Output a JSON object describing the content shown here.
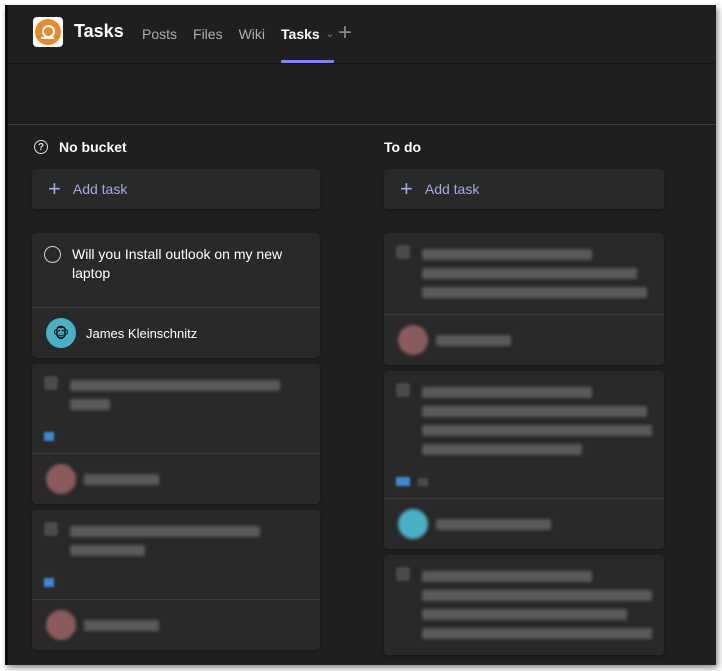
{
  "app": {
    "title": "Tasks",
    "logo_icon": "orange-circle-app-logo-icon",
    "accent_color": "#7f85f5",
    "link_color": "#a7a8e0"
  },
  "tabs": [
    {
      "label": "Posts",
      "active": false
    },
    {
      "label": "Files",
      "active": false
    },
    {
      "label": "Wiki",
      "active": false
    },
    {
      "label": "Tasks",
      "active": true,
      "has_dropdown": true
    }
  ],
  "add_tab_icon": "plus-icon",
  "buckets": [
    {
      "name": "No bucket",
      "icon": "question-circle-icon",
      "add_task_label": "Add task",
      "cards": [
        {
          "title": "Will you Install outlook on my new laptop",
          "assignee": "James Kleinschnitz",
          "redacted": false
        },
        {
          "title": null,
          "assignee": null,
          "redacted": true,
          "has_label": true
        },
        {
          "title": null,
          "assignee": null,
          "redacted": true,
          "has_label": true
        }
      ]
    },
    {
      "name": "To do",
      "icon": null,
      "add_task_label": "Add task",
      "cards": [
        {
          "title": null,
          "assignee": null,
          "redacted": true,
          "has_label": false
        },
        {
          "title": null,
          "assignee": null,
          "redacted": true,
          "has_label": true
        },
        {
          "title": null,
          "assignee": null,
          "redacted": true,
          "has_label": false
        }
      ]
    }
  ]
}
